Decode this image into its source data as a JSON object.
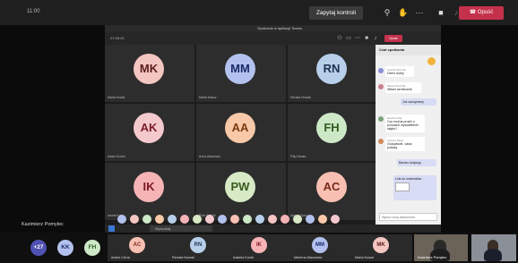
{
  "app": {
    "timer": "11:00",
    "request_control_label": "Zapytaj kontroli",
    "leave_label": "Opuść"
  },
  "shared_window": {
    "title": "Spotkanie w aplikacji Teams",
    "timer": "01:58:45",
    "leave_label": "Opuść",
    "search_placeholder": "Wyszukaj",
    "chat_title": "Czat spotkania",
    "top_label": "Ustaw pytanie pisane do wszystkich",
    "input_placeholder": "Wpisz nową wiadomość",
    "tiles": [
      {
        "initials": "MK",
        "name": "Maria Kowal",
        "color": "#f4c6c2",
        "text": "#5a1c1a"
      },
      {
        "initials": "MM",
        "name": "Marta Mazur",
        "color": "#b3c1ee",
        "text": "#1c2a6a"
      },
      {
        "initials": "RN",
        "name": "Renata Nowak",
        "color": "#b7cfe9",
        "text": "#1a3250"
      },
      {
        "initials": "AK",
        "name": "Adam Kozioł",
        "color": "#f4c9ce",
        "text": "#7a1c28"
      },
      {
        "initials": "AA",
        "name": "Anna Adamska",
        "color": "#f7c9a8",
        "text": "#7a3a10"
      },
      {
        "initials": "FH",
        "name": "Filip Hanke",
        "color": "#cde8c6",
        "text": "#2e5a22"
      },
      {
        "initials": "IK",
        "name": "Iwona Kot",
        "color": "#f5b3b6",
        "text": "#7a1820"
      },
      {
        "initials": "PW",
        "name": "Piotr Wójcik",
        "color": "#d7e9c5",
        "text": "#3a5a20"
      },
      {
        "initials": "AC",
        "name": "Adam Cicha",
        "color": "#f7c0b2",
        "text": "#7a2a18"
      }
    ],
    "chat_messages": [
      {
        "kind": "other",
        "sender": "Kamila Pietrzak",
        "text": "Dzień dobry"
      },
      {
        "kind": "other",
        "sender": "Marek Woźniak",
        "text": "Witam serdecznie"
      },
      {
        "kind": "mine",
        "sender": "",
        "text": "Już zaczynamy"
      },
      {
        "kind": "other",
        "sender": "Ewelina Maj",
        "text": "Czy można prosić o ponowne wyświetlenie slajdu?"
      },
      {
        "kind": "other",
        "sender": "Paulina Zając",
        "text": "Oczywiście, zaraz pokażę"
      },
      {
        "kind": "mine",
        "sender": "",
        "text": "Bardzo dziękuję"
      },
      {
        "kind": "mine",
        "sender": "",
        "text": "Link do materiałów"
      }
    ]
  },
  "presenter_label": "Kazimierz Pomylec",
  "strip": {
    "more_count": "+27",
    "avatars": [
      {
        "initials": "KK",
        "color": "#b3c1ee",
        "text": "#1c2a6a"
      },
      {
        "initials": "FH",
        "color": "#cde8c6",
        "text": "#2e5a22"
      }
    ],
    "tiles": [
      {
        "initials": "AC",
        "name": "Adam Cicha",
        "color": "#f7c0b2",
        "text": "#7a2a18"
      },
      {
        "initials": "RN",
        "name": "Renata Nowak",
        "color": "#b7cfe9",
        "text": "#1a3250"
      },
      {
        "initials": "IK",
        "name": "Izabela Kurek",
        "color": "#f5b3b6",
        "text": "#7a1820"
      },
      {
        "initials": "MM",
        "name": "Marlena Mazurska",
        "color": "#b3c1ee",
        "text": "#1c2a6a"
      },
      {
        "initials": "MK",
        "name": "Maria Kowal",
        "color": "#f4c6c2",
        "text": "#5a1c1a"
      }
    ],
    "video_name": "Kazimierz Pomylec"
  }
}
